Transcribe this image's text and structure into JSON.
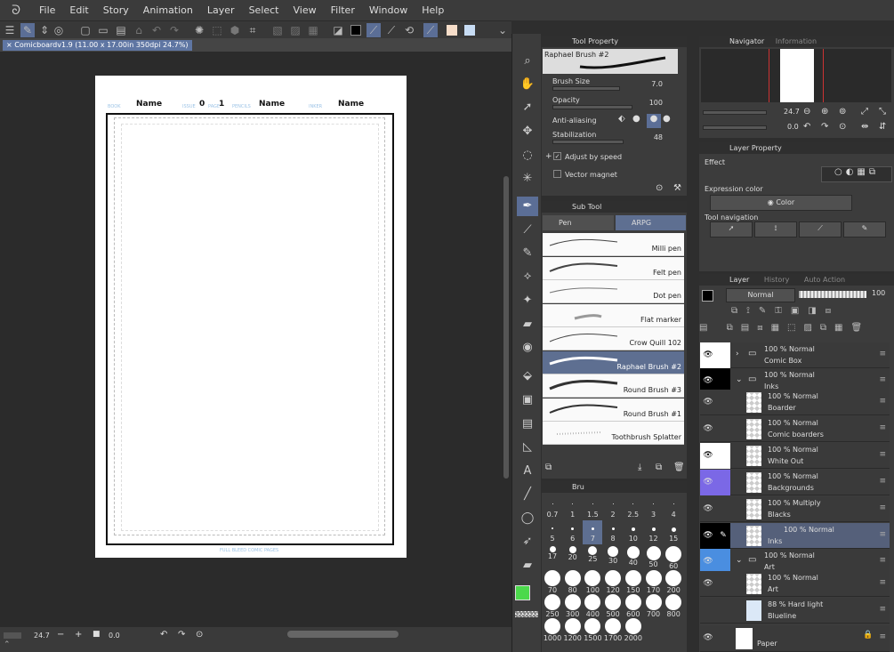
{
  "menu": {
    "items": [
      "File",
      "Edit",
      "Story",
      "Animation",
      "Layer",
      "Select",
      "View",
      "Filter",
      "Window",
      "Help"
    ]
  },
  "colors": {
    "accent": "#5b6e96",
    "main_color": "#4cd94c",
    "sub_color": "#000000",
    "toolbar_swatch1": "#f6ddc9",
    "toolbar_swatch2": "#c7dcf4"
  },
  "document": {
    "tab_title": "Comicboardv1.9 (11.00 x 17.00in 350dpi 24.7%)",
    "page": {
      "book_label": "BOOK",
      "name1": "Name",
      "issue_label": "ISSUE",
      "issue": "0",
      "page_label": "PAGE",
      "page": "1",
      "pencils_label": "PENCILS",
      "name2": "Name",
      "inker_label": "INKER",
      "name3": "Name",
      "footer": "FULL BLEED COMIC PAGES"
    }
  },
  "status": {
    "zoom": "24.7",
    "angle": "0.0"
  },
  "tool_property": {
    "title": "Tool Property",
    "brush_name": "Raphael Brush #2",
    "brush_size_label": "Brush Size",
    "brush_size": "7.0",
    "opacity_label": "Opacity",
    "opacity": "100",
    "antialias_label": "Anti-aliasing",
    "stabilization_label": "Stabilization",
    "stabilization": "48",
    "adjust_speed": "Adjust by speed",
    "vector_magnet": "Vector magnet"
  },
  "sub_tool": {
    "title": "Sub Tool",
    "tabs": [
      "Pen",
      "ARPG"
    ],
    "brushes": [
      "Milli pen",
      "Felt pen",
      "Dot pen",
      "Flat marker",
      "Crow Quill 102",
      "Raphael Brush #2",
      "Round Brush #3",
      "Round Brush #1",
      "Toothbrush Splatter"
    ]
  },
  "brush_size": {
    "tab": "Bru",
    "sizes": [
      "0.7",
      "1",
      "1.5",
      "2",
      "2.5",
      "3",
      "4",
      "5",
      "6",
      "7",
      "8",
      "10",
      "12",
      "15",
      "17",
      "20",
      "25",
      "30",
      "40",
      "50",
      "60",
      "70",
      "80",
      "100",
      "120",
      "150",
      "170",
      "200",
      "250",
      "300",
      "400",
      "500",
      "600",
      "700",
      "800",
      "1000",
      "1200",
      "1500",
      "1700",
      "2000"
    ]
  },
  "navigator": {
    "tab": "Navigator",
    "tab2": "Information",
    "zoom": "24.7",
    "angle": "0.0"
  },
  "layer_property": {
    "title": "Layer Property",
    "effect_label": "Effect",
    "expression_label": "Expression color",
    "expression_value": "Color",
    "toolnav_label": "Tool navigation"
  },
  "layer_panel": {
    "tabs": [
      "Layer",
      "History",
      "Auto Action"
    ],
    "blend": "Normal",
    "opacity": "100",
    "layers": [
      {
        "top": "100 % Normal",
        "name": "Comic Box"
      },
      {
        "top": "100 % Normal",
        "name": "Inks"
      },
      {
        "top": "100 % Normal",
        "name": "Boarder"
      },
      {
        "top": "100 % Normal",
        "name": "Comic boarders"
      },
      {
        "top": "100 % Normal",
        "name": "White Out"
      },
      {
        "top": "100 % Normal",
        "name": "Backgrounds"
      },
      {
        "top": "100 % Multiply",
        "name": "Blacks"
      },
      {
        "top": "100 % Normal",
        "name": "Inks"
      },
      {
        "top": "100 % Normal",
        "name": "Art"
      },
      {
        "top": "100 % Normal",
        "name": "Art"
      },
      {
        "top": "88 % Hard light",
        "name": "Blueline"
      },
      {
        "top": "",
        "name": "Paper"
      }
    ]
  }
}
